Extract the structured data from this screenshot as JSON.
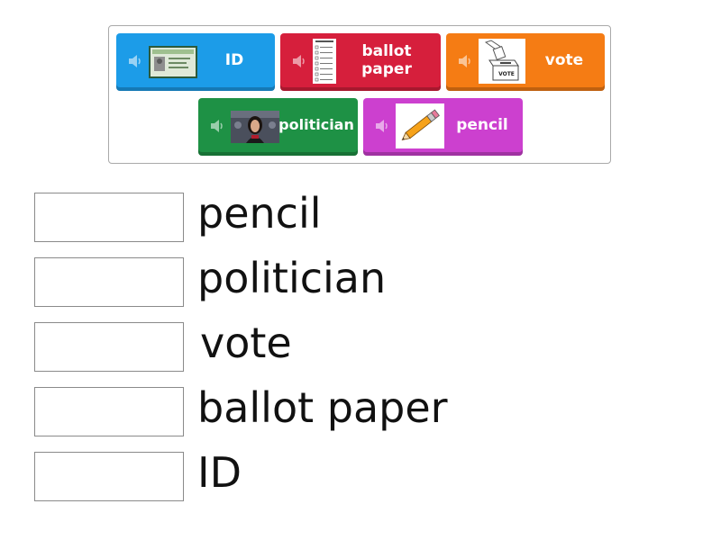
{
  "tray": {
    "cards": [
      {
        "label": "ID",
        "color": "#1c9ce8",
        "thumb": "id-card"
      },
      {
        "label": "ballot paper",
        "color": "#d61f3c",
        "thumb": "ballot-paper"
      },
      {
        "label": "vote",
        "color": "#f57c14",
        "thumb": "ballot-box"
      },
      {
        "label": "politician",
        "color": "#1e9145",
        "thumb": "portrait"
      },
      {
        "label": "pencil",
        "color": "#cc40cf",
        "thumb": "pencil"
      }
    ],
    "vote_thumb_caption": "VOTE"
  },
  "targets": [
    {
      "word": "pencil"
    },
    {
      "word": "politician"
    },
    {
      "word": "vote"
    },
    {
      "word": "ballot paper"
    },
    {
      "word": "ID"
    }
  ]
}
